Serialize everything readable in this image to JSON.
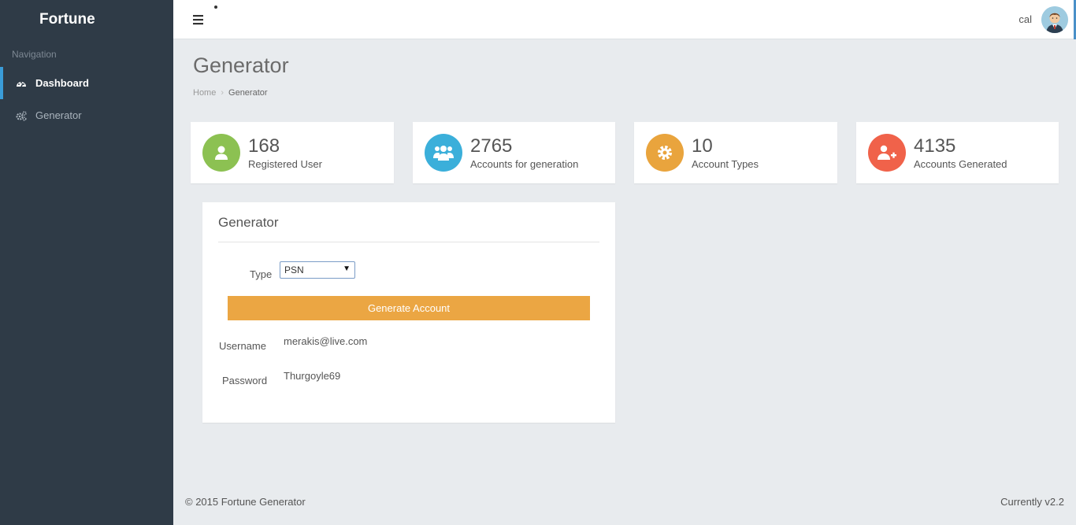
{
  "brand": "Fortune",
  "sidebar": {
    "heading": "Navigation",
    "items": [
      {
        "label": "Dashboard",
        "icon": "dashboard-icon",
        "active": true
      },
      {
        "label": "Generator",
        "icon": "cogs-icon",
        "active": false
      }
    ]
  },
  "topbar": {
    "user_name": "cal",
    "menu_icon": "hamburger-icon",
    "avatar_icon": "avatar-icon"
  },
  "page": {
    "title": "Generator",
    "breadcrumb": [
      "Home",
      "Generator"
    ]
  },
  "stats": [
    {
      "value": "168",
      "label": "Registered User",
      "color": "#8cc152",
      "icon": "user-icon"
    },
    {
      "value": "2765",
      "label": "Accounts for generation",
      "color": "#3bafda",
      "icon": "users-icon"
    },
    {
      "value": "10",
      "label": "Account Types",
      "color": "#e9a43d",
      "icon": "gear-icon"
    },
    {
      "value": "4135",
      "label": "Accounts Generated",
      "color": "#f0624a",
      "icon": "user-plus-icon"
    }
  ],
  "generator": {
    "title": "Generator",
    "type_label": "Type",
    "type_value": "PSN",
    "button_label": "Generate Account",
    "button_color": "#eba643",
    "username_label": "Username",
    "username_value": "merakis@live.com",
    "password_label": "Password",
    "password_value": "Thurgoyle69"
  },
  "footer": {
    "copyright": "© 2015 Fortune Generator",
    "version": "Currently v2.2"
  }
}
